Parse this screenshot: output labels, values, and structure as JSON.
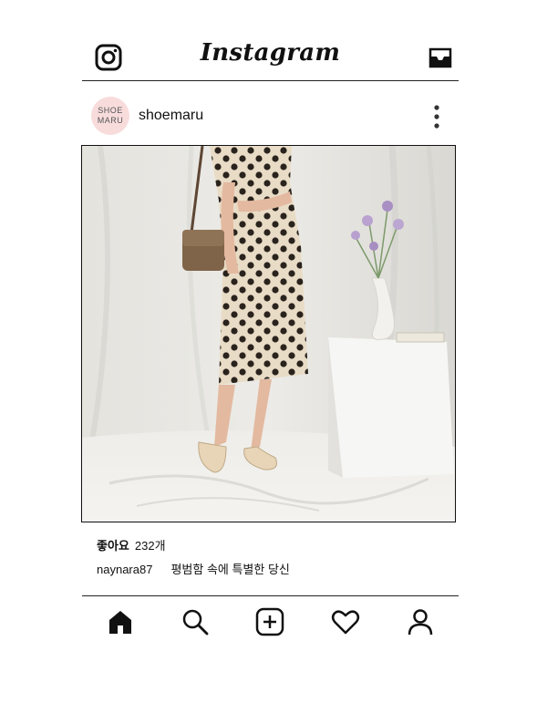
{
  "header": {
    "logo_text": "Instagram",
    "left_icon": "instagram-camera-icon",
    "right_icon": "inbox-icon"
  },
  "post": {
    "avatar_line1": "SHOE",
    "avatar_line2": "MARU",
    "username": "shoemaru",
    "menu_icon": "more-vertical-icon",
    "image_description": "photo",
    "likes_label": "좋아요",
    "likes_count": "232개",
    "caption_user": "naynara87",
    "caption_text": "평범함 속에 특별한 당신"
  },
  "nav": {
    "items": [
      "home-icon",
      "search-icon",
      "add-post-icon",
      "heart-icon",
      "profile-icon"
    ]
  },
  "colors": {
    "avatar_bg": "#f8dcdc",
    "text": "#111111",
    "line": "#222222"
  }
}
